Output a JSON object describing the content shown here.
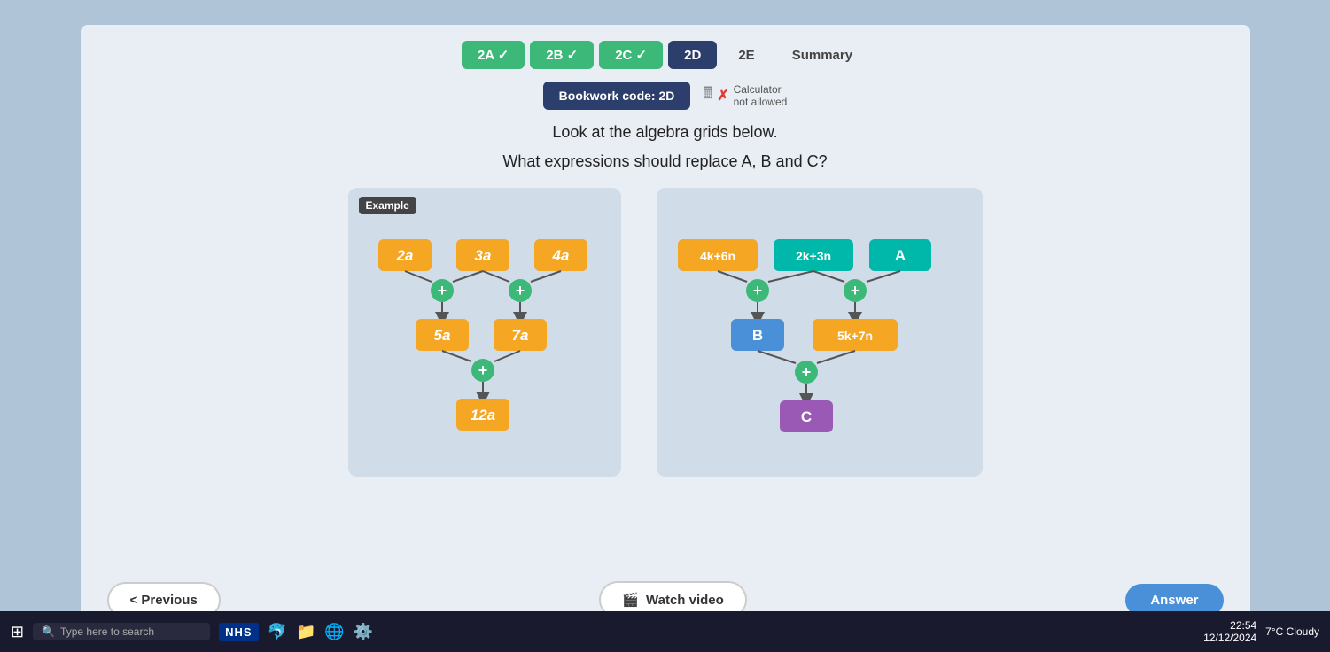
{
  "tabs": [
    {
      "id": "2A",
      "label": "2A ✓",
      "state": "completed"
    },
    {
      "id": "2B",
      "label": "2B ✓",
      "state": "completed"
    },
    {
      "id": "2C",
      "label": "2C ✓",
      "state": "completed"
    },
    {
      "id": "2D",
      "label": "2D",
      "state": "active"
    },
    {
      "id": "2E",
      "label": "2E",
      "state": "inactive"
    },
    {
      "id": "Summary",
      "label": "Summary",
      "state": "inactive"
    }
  ],
  "bookwork": {
    "label": "Bookwork code: 2D",
    "calculator_line1": "Calculator",
    "calculator_line2": "not allowed"
  },
  "question": {
    "line1": "Look at the algebra grids below.",
    "line2": "What expressions should replace A, B and C?"
  },
  "example_diagram": {
    "label": "Example",
    "nodes_top": [
      "2a",
      "3a",
      "4a"
    ],
    "nodes_mid": [
      "5a",
      "7a"
    ],
    "node_bottom": "12a"
  },
  "problem_diagram": {
    "top_nodes": [
      "4k+6n",
      "2k+3n",
      "A"
    ],
    "mid_nodes": [
      "B",
      "5k+7n"
    ],
    "bottom_node": "C"
  },
  "buttons": {
    "previous": "< Previous",
    "watch_video": "Watch video",
    "answer": "Answer"
  },
  "taskbar": {
    "search_placeholder": "Type here to search",
    "nhs_label": "NHS",
    "weather": "7°C Cloudy",
    "time": "22:54",
    "date": "12/12/2024"
  }
}
